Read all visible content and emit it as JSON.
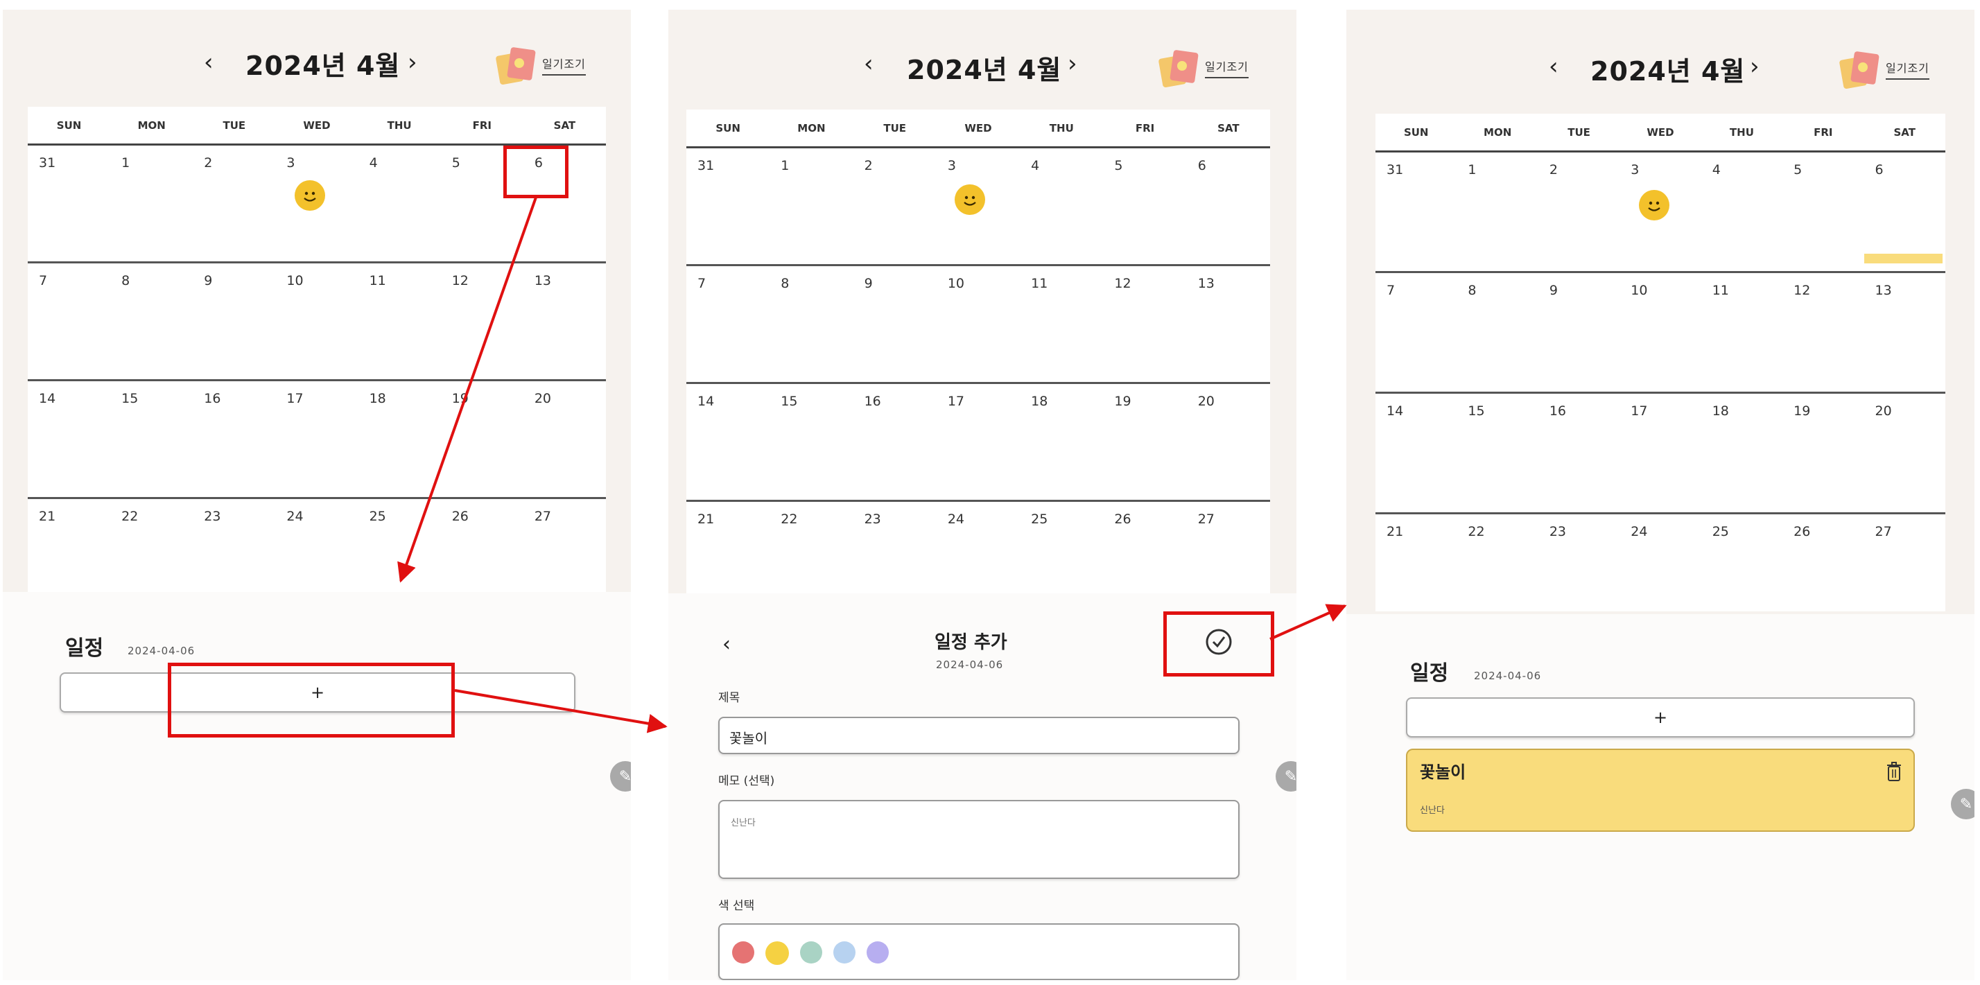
{
  "calendar": {
    "year_month": "2024년 4월",
    "prev": "‹",
    "next": "›",
    "diary_label": "일기조기",
    "days_of_week": [
      "SUN",
      "MON",
      "TUE",
      "WED",
      "THU",
      "FRI",
      "SAT"
    ],
    "weeks": [
      [
        "31",
        "1",
        "2",
        "3",
        "4",
        "5",
        "6"
      ],
      [
        "7",
        "8",
        "9",
        "10",
        "11",
        "12",
        "13"
      ],
      [
        "14",
        "15",
        "16",
        "17",
        "18",
        "19",
        "20"
      ],
      [
        "21",
        "22",
        "23",
        "24",
        "25",
        "26",
        "27"
      ]
    ]
  },
  "panel1": {
    "schedule_title": "일정",
    "schedule_date": "2024-04-06",
    "add_label": "+"
  },
  "panel2": {
    "back": "‹",
    "title": "일정 추가",
    "date": "2024-04-06",
    "title_label": "제목",
    "title_value": "꽃놀이",
    "memo_label": "메모 (선택)",
    "memo_value": "신난다",
    "color_label": "색 선택",
    "colors": [
      "#e57373",
      "#f5d142",
      "#a9d3c4",
      "#b7d2f0",
      "#b7aef0"
    ]
  },
  "panel3": {
    "schedule_title": "일정",
    "schedule_date": "2024-04-06",
    "add_label": "+",
    "event_title": "꽃놀이",
    "event_memo": "신난다",
    "event_color": "#f9dc7c"
  },
  "theme": {
    "highlight_color": "#e01010",
    "background": "#f6f2ee",
    "smiley_color": "#f3c12b"
  }
}
